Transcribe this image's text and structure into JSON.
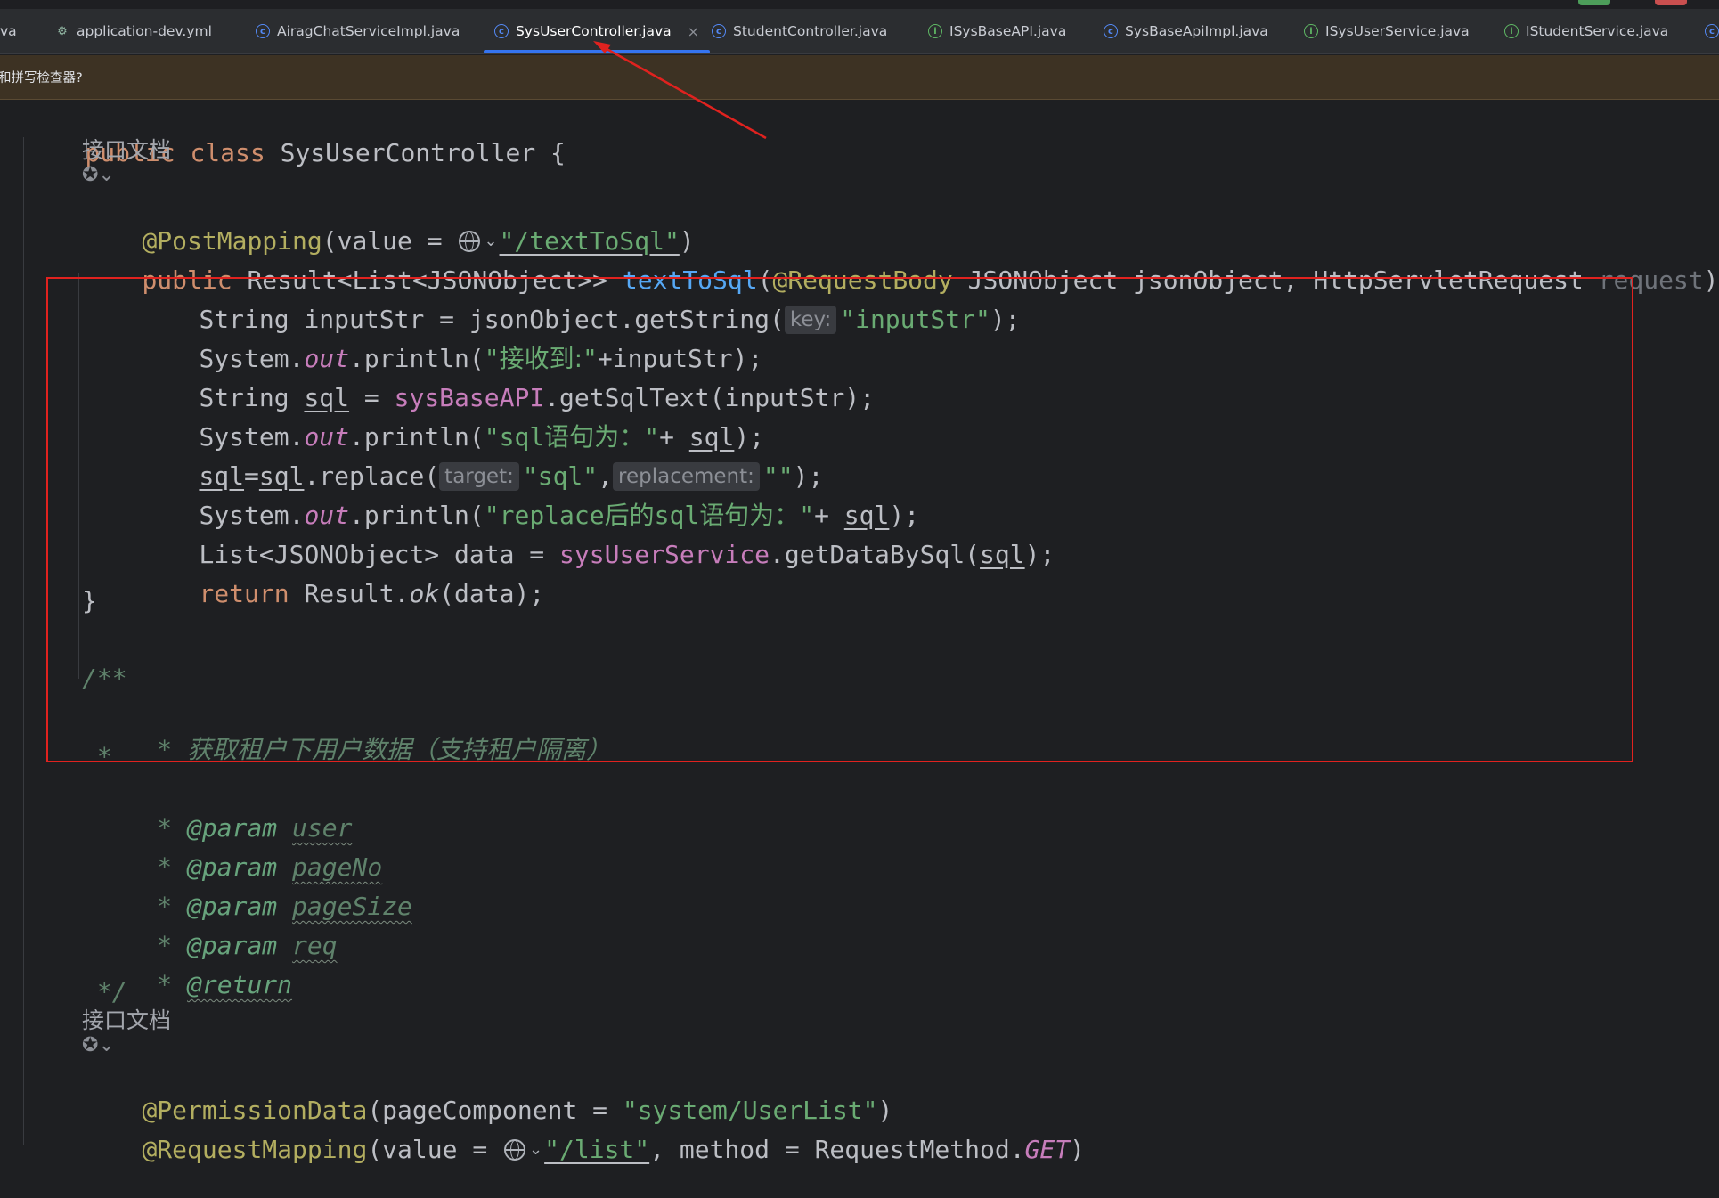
{
  "tabs": [
    {
      "label": "va",
      "icon": "none"
    },
    {
      "label": "application-dev.yml",
      "icon": "yaml-file-icon"
    },
    {
      "label": "AiragChatServiceImpl.java",
      "icon": "class-icon"
    },
    {
      "label": "SysUserController.java",
      "icon": "class-icon",
      "active": true
    },
    {
      "label": "StudentController.java",
      "icon": "class-icon"
    },
    {
      "label": "ISysBaseAPI.java",
      "icon": "interface-icon"
    },
    {
      "label": "SysBaseApiImpl.java",
      "icon": "class-icon"
    },
    {
      "label": "ISysUserService.java",
      "icon": "interface-icon"
    },
    {
      "label": "IStudentService.java",
      "icon": "interface-icon"
    }
  ],
  "notice": {
    "text": "和拼写检查器?"
  },
  "code": {
    "class_decl": {
      "kw": "public class",
      "name": "SysUserController {"
    },
    "doc_label_1": "接口文档",
    "l1": {
      "anno": "@PostMapping",
      "p1": "(value = ",
      "path": "\"/textToSql\"",
      "p2": ")"
    },
    "l2": {
      "kw": "public",
      "t1": " Result<List<JSONObject>> ",
      "fn": "textToSql",
      "t2": "(",
      "anno": "@RequestBody",
      "t3": " JSONObject jsonObject, HttpServletRequest ",
      "gray": "request",
      "t4": ") {"
    },
    "l3": {
      "t1": "String inputStr = jsonObject.getString(",
      "hint": "key:",
      "str": "\"inputStr\"",
      "t2": ");"
    },
    "l4": {
      "t1": "System.",
      "out": "out",
      "t2": ".println(",
      "s1": "\"",
      "s2": "接收到:",
      "s3": "\"",
      "t3": "+inputStr);"
    },
    "l5": {
      "t1": "String ",
      "var": "sql",
      "t2": " = ",
      "fld": "sysBaseAPI",
      "t3": ".getSqlText(inputStr);"
    },
    "l6": {
      "t1": "System.",
      "out": "out",
      "t2": ".println(",
      "s1": "\"sql",
      "s2": "语句为：",
      "s3": "\"",
      "t3": "+ ",
      "var": "sql",
      "t4": ");"
    },
    "l7": {
      "v1": "sql",
      "t1": "=",
      "v2": "sql",
      "t2": ".replace(",
      "hint1": "target:",
      "str1": "\"sql\"",
      "t3": ",",
      "hint2": "replacement:",
      "str2": "\"\"",
      "t4": ");"
    },
    "l8": {
      "t1": "System.",
      "out": "out",
      "t2": ".println(",
      "s1": "\"replace",
      "s2": "后的",
      "s3": "sql",
      "s4": "语句为：",
      "s5": "\"",
      "t3": "+ ",
      "var": "sql",
      "t4": ");"
    },
    "l9": {
      "t1": "List<JSONObject> data = ",
      "fld": "sysUserService",
      "t2": ".getDataBySql(",
      "var": "sql",
      "t3": ");"
    },
    "l10": {
      "kw": "return",
      "t1": " Result.",
      "fn": "ok",
      "t2": "(data);"
    },
    "l11": "}",
    "c1": "/**",
    "c2": {
      "star": " * ",
      "text": "获取租户下用户数据（支持租户隔离）"
    },
    "c3": " *",
    "params": [
      {
        "star": " * ",
        "tag": "@param",
        "name": "user"
      },
      {
        "star": " * ",
        "tag": "@param",
        "name": "pageNo"
      },
      {
        "star": " * ",
        "tag": "@param",
        "name": "pageSize"
      },
      {
        "star": " * ",
        "tag": "@param",
        "name": "req"
      }
    ],
    "c_return": {
      "star": " * ",
      "tag": "@return"
    },
    "c_end": " */",
    "doc_label_2": "接口文档",
    "l12": {
      "anno": "@PermissionData",
      "t1": "(pageComponent = ",
      "str": "\"system/UserList\"",
      "t2": ")"
    },
    "l13": {
      "anno": "@RequestMapping",
      "t1": "(value = ",
      "path": "\"/list\"",
      "t2": ", method = RequestMethod.",
      "get": "GET",
      "t3": ")"
    }
  },
  "colors": {
    "annotation_box": "#e0221f",
    "arrow": "#e0221f",
    "active_tab_underline": "#3574f0"
  }
}
